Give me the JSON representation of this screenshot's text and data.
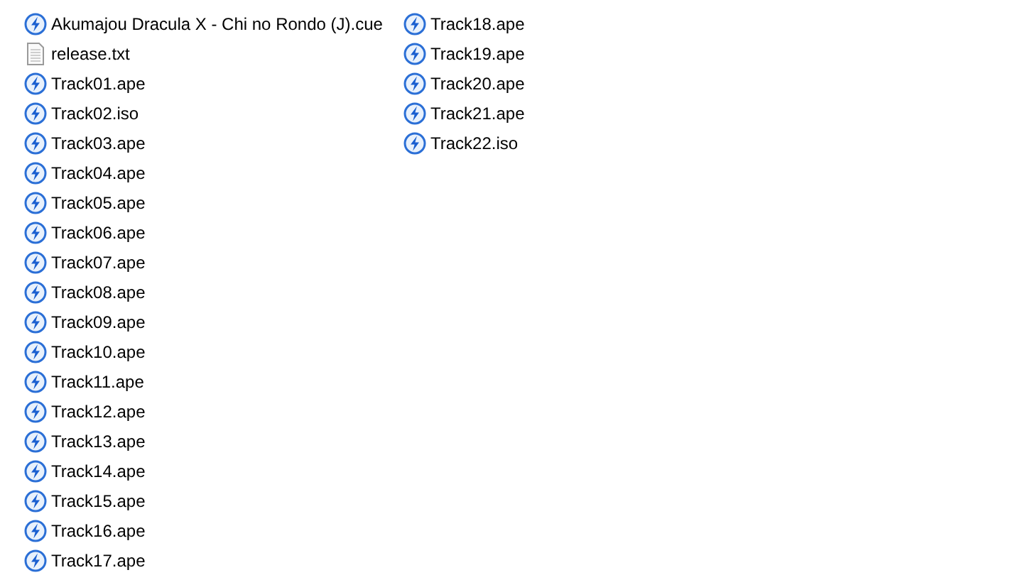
{
  "files": [
    {
      "name": "Akumajou Dracula X - Chi no Rondo (J).cue",
      "kind": "disc"
    },
    {
      "name": "release.txt",
      "kind": "text"
    },
    {
      "name": "Track01.ape",
      "kind": "disc"
    },
    {
      "name": "Track02.iso",
      "kind": "disc"
    },
    {
      "name": "Track03.ape",
      "kind": "disc"
    },
    {
      "name": "Track04.ape",
      "kind": "disc"
    },
    {
      "name": "Track05.ape",
      "kind": "disc"
    },
    {
      "name": "Track06.ape",
      "kind": "disc"
    },
    {
      "name": "Track07.ape",
      "kind": "disc"
    },
    {
      "name": "Track08.ape",
      "kind": "disc"
    },
    {
      "name": "Track09.ape",
      "kind": "disc"
    },
    {
      "name": "Track10.ape",
      "kind": "disc"
    },
    {
      "name": "Track11.ape",
      "kind": "disc"
    },
    {
      "name": "Track12.ape",
      "kind": "disc"
    },
    {
      "name": "Track13.ape",
      "kind": "disc"
    },
    {
      "name": "Track14.ape",
      "kind": "disc"
    },
    {
      "name": "Track15.ape",
      "kind": "disc"
    },
    {
      "name": "Track16.ape",
      "kind": "disc"
    },
    {
      "name": "Track17.ape",
      "kind": "disc"
    },
    {
      "name": "Track18.ape",
      "kind": "disc"
    },
    {
      "name": "Track19.ape",
      "kind": "disc"
    },
    {
      "name": "Track20.ape",
      "kind": "disc"
    },
    {
      "name": "Track21.ape",
      "kind": "disc"
    },
    {
      "name": "Track22.iso",
      "kind": "disc"
    }
  ]
}
